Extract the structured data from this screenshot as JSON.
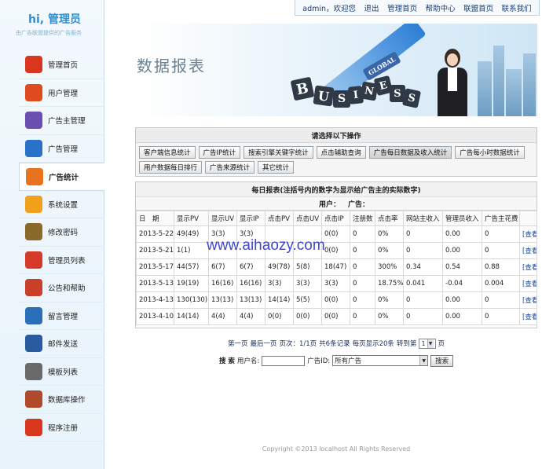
{
  "logo": {
    "title": "hi, 管理员",
    "subtitle": "由广告联盟提供的广告服务"
  },
  "topnav": {
    "user": "admin，欢迎您",
    "links": [
      "退出",
      "管理首页",
      "帮助中心",
      "联盟首页",
      "联系我们"
    ]
  },
  "sidebar": {
    "items": [
      {
        "label": "管理首页",
        "icon": "home-icon",
        "color": "#d9361f"
      },
      {
        "label": "用户管理",
        "icon": "user-icon",
        "color": "#e04a1f"
      },
      {
        "label": "广告主管理",
        "icon": "advertiser-icon",
        "color": "#6b4fb0"
      },
      {
        "label": "广告管理",
        "icon": "ad-icon",
        "color": "#2a72c8"
      },
      {
        "label": "广告统计",
        "icon": "stats-icon",
        "color": "#e8731f"
      },
      {
        "label": "系统设置",
        "icon": "settings-icon",
        "color": "#f0a01a"
      },
      {
        "label": "修改密码",
        "icon": "password-icon",
        "color": "#8a6a2a"
      },
      {
        "label": "管理员列表",
        "icon": "admin-list-icon",
        "color": "#d63a2a"
      },
      {
        "label": "公告和帮助",
        "icon": "notice-icon",
        "color": "#c8402a"
      },
      {
        "label": "留言管理",
        "icon": "message-icon",
        "color": "#2a6fb8"
      },
      {
        "label": "邮件发送",
        "icon": "mail-icon",
        "color": "#2a5aa0"
      },
      {
        "label": "模板列表",
        "icon": "template-icon",
        "color": "#6a6a6a"
      },
      {
        "label": "数据库操作",
        "icon": "database-icon",
        "color": "#b04a2a"
      },
      {
        "label": "程序注册",
        "icon": "register-icon",
        "color": "#d9361f"
      }
    ]
  },
  "banner": {
    "title": "数据报表",
    "brand_letters": [
      "B",
      "U",
      "S",
      "I",
      "N",
      "E",
      "S",
      "S"
    ],
    "globe_text": "GLOBAL"
  },
  "ops": {
    "heading": "请选择以下操作",
    "buttons": [
      "客户端信息统计",
      "广告IP统计",
      "搜索引擎关键字统计",
      "点击辅助查询",
      "广告每日数据及收入统计",
      "广告每小时数据统计",
      "用户数据每日排行",
      "广告来源统计",
      "其它统计"
    ],
    "selected": "广告每日数据及收入统计"
  },
  "report": {
    "title": "每日报表(注括号内的数字为显示给广告主的实际数字)",
    "user_label": "用户：",
    "ad_label": "广告：",
    "columns": [
      "日　期",
      "显示PV",
      "显示UV",
      "显示IP",
      "点击PV",
      "点击UV",
      "点击IP",
      "注册数",
      "点击率",
      "网站主收入",
      "管理员收入",
      "广告主花费",
      ""
    ],
    "rows": [
      [
        "2013-5-22",
        "49(49)",
        "3(3)",
        "3(3)",
        "",
        "",
        "0(0)",
        "0",
        "0%",
        "0",
        "0.00",
        "0",
        "[查看]"
      ],
      [
        "2013-5-21",
        "1(1)",
        "",
        "",
        "",
        "",
        "0(0)",
        "0",
        "0%",
        "0",
        "0.00",
        "0",
        "[查看]"
      ],
      [
        "2013-5-17",
        "44(57)",
        "6(7)",
        "6(7)",
        "49(78)",
        "5(8)",
        "18(47)",
        "0",
        "300%",
        "0.34",
        "0.54",
        "0.88",
        "[查看]"
      ],
      [
        "2013-5-13",
        "19(19)",
        "16(16)",
        "16(16)",
        "3(3)",
        "3(3)",
        "3(3)",
        "0",
        "18.75%",
        "0.041",
        "-0.04",
        "0.004",
        "[查看]"
      ],
      [
        "2013-4-13",
        "130(130)",
        "13(13)",
        "13(13)",
        "14(14)",
        "5(5)",
        "0(0)",
        "0",
        "0%",
        "0",
        "0.00",
        "0",
        "[查看]"
      ],
      [
        "2013-4-10",
        "14(14)",
        "4(4)",
        "4(4)",
        "0(0)",
        "0(0)",
        "0(0)",
        "0",
        "0%",
        "0",
        "0.00",
        "0",
        "[查看]"
      ]
    ]
  },
  "watermark": "www.aihaozy.com",
  "pager": {
    "first": "第一页",
    "last": "最后一页",
    "page_info": "页次：1/1页",
    "total": "共6条记录",
    "per_page": "每页显示20条",
    "goto_label": "转到第",
    "goto_value": "1",
    "page_suffix": "页"
  },
  "search": {
    "label_bold": "搜 索",
    "username_label": "用户名:",
    "username_value": "",
    "adid_label": "广告ID:",
    "ad_select": "所有广告",
    "button": "搜索"
  },
  "footer": "Copyright ©2013 localhost All Rights Reserved"
}
